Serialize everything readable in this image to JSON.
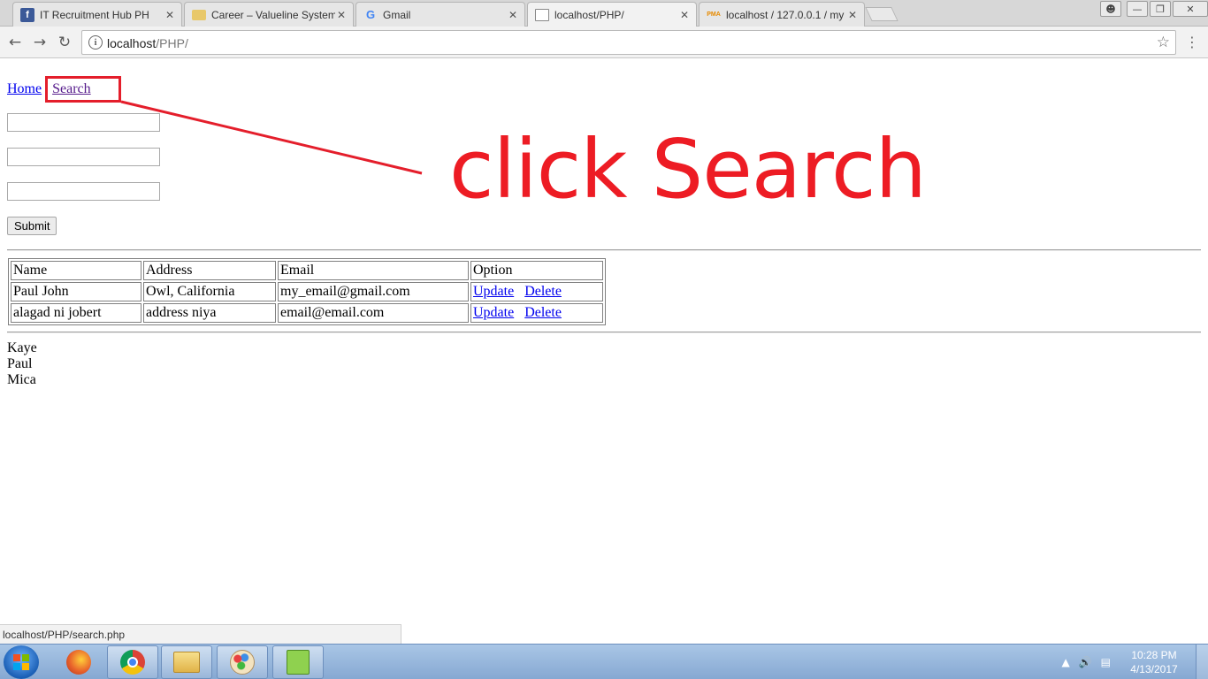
{
  "browser": {
    "tabs": [
      {
        "title": "IT Recruitment Hub PH",
        "icon": "facebook-icon"
      },
      {
        "title": "Career – Valueline Systems",
        "icon": "folder-icon"
      },
      {
        "title": "Gmail",
        "icon": "google-icon"
      },
      {
        "title": "localhost/PHP/",
        "icon": "document-icon",
        "active": true
      },
      {
        "title": "localhost / 127.0.0.1 / my",
        "icon": "phpmyadmin-icon"
      }
    ],
    "address": {
      "host": "localhost",
      "path": "/PHP/"
    },
    "status_url": "localhost/PHP/search.php"
  },
  "page": {
    "nav": {
      "home": "Home",
      "search": "Search"
    },
    "form": {
      "submit_label": "Submit",
      "fields": [
        "",
        "",
        ""
      ]
    },
    "table": {
      "headers": [
        "Name",
        "Address",
        "Email",
        "Option"
      ],
      "rows": [
        {
          "name": "Paul John",
          "address": "Owl, California",
          "email": "my_email@gmail.com",
          "update": "Update",
          "delete": "Delete"
        },
        {
          "name": "alagad ni jobert",
          "address": "address niya",
          "email": "email@email.com",
          "update": "Update",
          "delete": "Delete"
        }
      ]
    },
    "names": [
      "Kaye",
      "Paul",
      "Mica"
    ]
  },
  "annotation": {
    "text": "click Search",
    "color": "#ed1c24"
  },
  "taskbar": {
    "clock_time": "10:28 PM",
    "clock_date": "4/13/2017",
    "apps": [
      "firefox-icon",
      "chrome-icon",
      "file-explorer-icon",
      "paint-icon",
      "notepad-plus-plus-icon"
    ]
  }
}
